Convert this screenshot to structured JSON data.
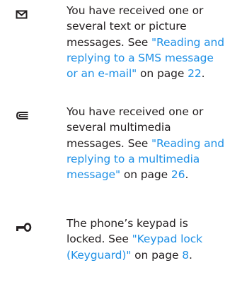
{
  "entries": [
    {
      "icon": "envelope-icon",
      "lines": [
        [
          {
            "t": "You have received one or",
            "link": false
          }
        ],
        [
          {
            "t": "several text or picture",
            "link": false
          }
        ],
        [
          {
            "t": "messages. See ",
            "link": false
          },
          {
            "t": "\"Reading and",
            "link": true
          }
        ],
        [
          {
            "t": "replying to a SMS message",
            "link": true
          }
        ],
        [
          {
            "t": "or an e-mail\"",
            "link": true
          },
          {
            "t": " on page ",
            "link": false
          },
          {
            "t": "22",
            "link": true
          },
          {
            "t": ".",
            "link": false
          }
        ]
      ]
    },
    {
      "icon": "multimedia-message-icon",
      "lines": [
        [
          {
            "t": "You have received one or",
            "link": false
          }
        ],
        [
          {
            "t": "several multimedia",
            "link": false
          }
        ],
        [
          {
            "t": "messages. See ",
            "link": false
          },
          {
            "t": "\"Reading and",
            "link": true
          }
        ],
        [
          {
            "t": "replying to a multimedia",
            "link": true
          }
        ],
        [
          {
            "t": "message\"",
            "link": true
          },
          {
            "t": " on page ",
            "link": false
          },
          {
            "t": "26",
            "link": true
          },
          {
            "t": ".",
            "link": false
          }
        ]
      ]
    },
    {
      "icon": "key-lock-icon",
      "lines": [
        [
          {
            "t": "The phone’s keypad is",
            "link": false
          }
        ],
        [
          {
            "t": "locked. See ",
            "link": false
          },
          {
            "t": "\"Keypad lock",
            "link": true
          }
        ],
        [
          {
            "t": "(Keyguard)\"",
            "link": true
          },
          {
            "t": " on page ",
            "link": false
          },
          {
            "t": "8",
            "link": true
          },
          {
            "t": ".",
            "link": false
          }
        ]
      ]
    }
  ],
  "colors": {
    "text": "#231f20",
    "link": "#1e90e6"
  }
}
